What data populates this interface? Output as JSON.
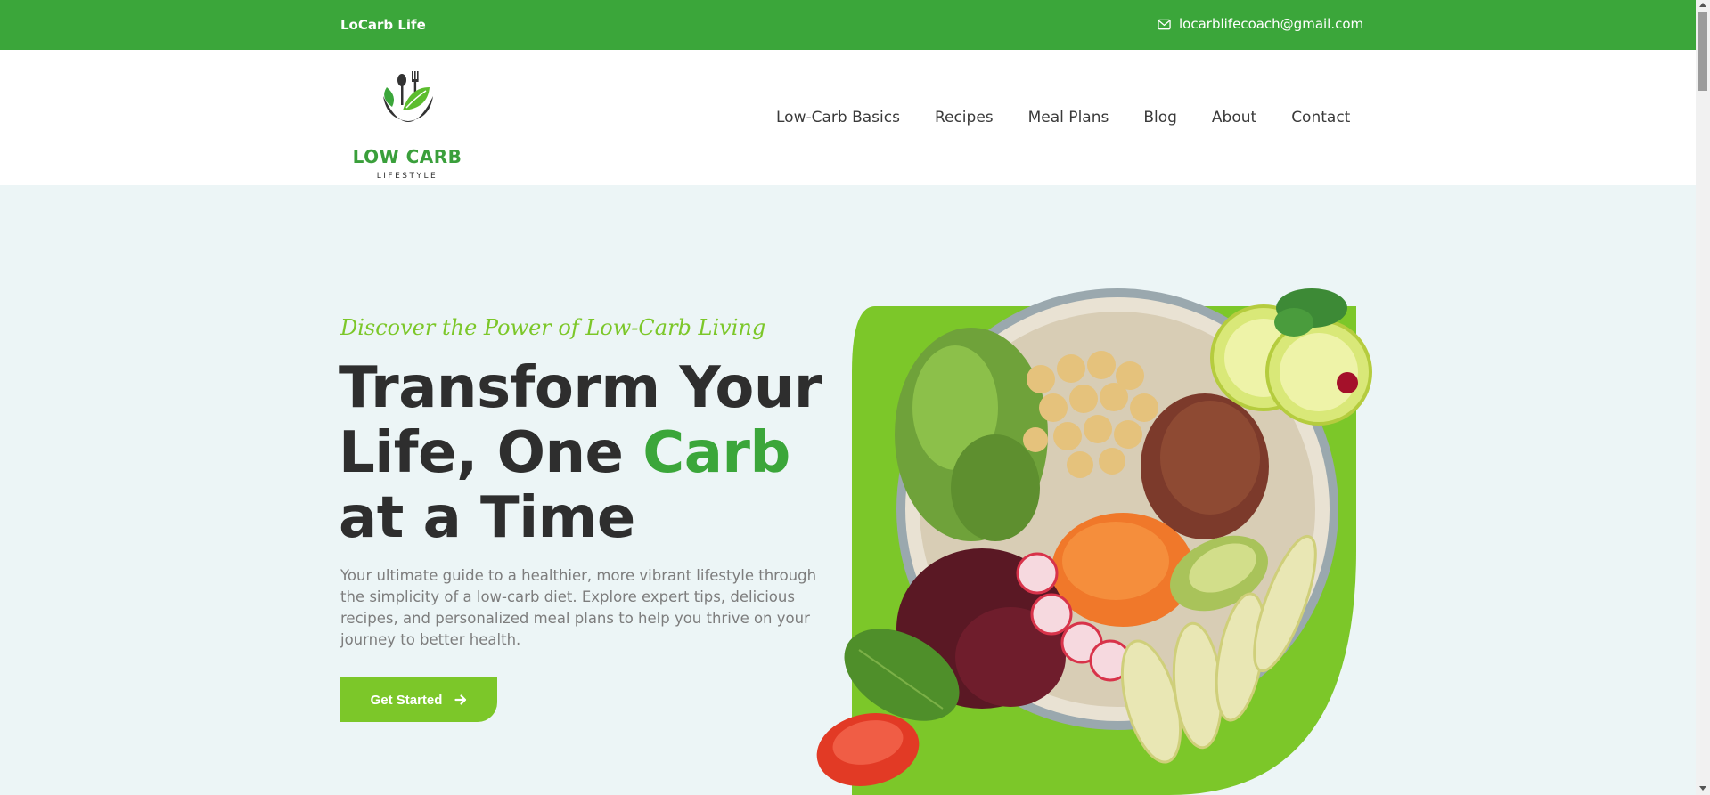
{
  "topbar": {
    "brand": "LoCarb Life",
    "email": "locarblifecoach@gmail.com",
    "email_icon": "envelope-icon",
    "bg_color": "#3ba63a"
  },
  "logo": {
    "name": "LOW CARB",
    "subtitle": "LIFESTYLE"
  },
  "nav": {
    "items": [
      {
        "label": "Low-Carb Basics"
      },
      {
        "label": "Recipes"
      },
      {
        "label": "Meal Plans"
      },
      {
        "label": "Blog"
      },
      {
        "label": "About"
      },
      {
        "label": "Contact"
      }
    ]
  },
  "hero": {
    "tagline": "Discover the Power of Low-Carb Living",
    "headline_part1": "Transform Your Life, One ",
    "headline_accent": "Carb",
    "headline_part2": " at a Time",
    "description": "Your ultimate guide to a healthier, more vibrant lifestyle through the simplicity of a low-carb diet. Explore expert tips, delicious recipes, and personalized meal plans to help you thrive on your journey to better health.",
    "cta_label": "Get Started",
    "cta_icon": "arrow-right-icon",
    "accent_color": "#7cc729"
  }
}
